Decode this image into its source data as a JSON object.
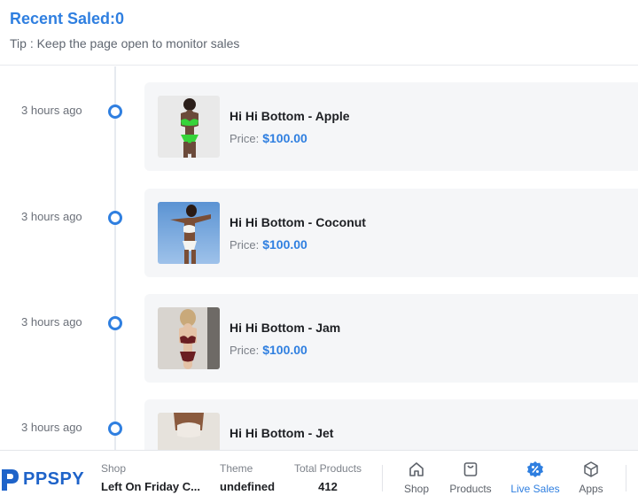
{
  "header": {
    "title": "Recent Saled:0",
    "tip": "Tip : Keep the page open to monitor sales"
  },
  "price_label": "Price:",
  "sales": [
    {
      "time": "3 hours ago",
      "name": "Hi Hi Bottom - Apple",
      "price": "$100.00",
      "thumb": "bikini-green"
    },
    {
      "time": "3 hours ago",
      "name": "Hi Hi Bottom - Coconut",
      "price": "$100.00",
      "thumb": "bikini-white"
    },
    {
      "time": "3 hours ago",
      "name": "Hi Hi Bottom - Jam",
      "price": "$100.00",
      "thumb": "bikini-maroon"
    },
    {
      "time": "3 hours ago",
      "name": "Hi Hi Bottom - Jet",
      "price": "",
      "thumb": "bikini-jet"
    }
  ],
  "footer": {
    "logo": "PPSPY",
    "shop": {
      "label": "Shop",
      "value": "Left On Friday C..."
    },
    "theme": {
      "label": "Theme",
      "value": "undefined"
    },
    "total_products": {
      "label": "Total Products",
      "value": "412"
    },
    "nav": [
      {
        "label": "Shop",
        "icon": "home-icon",
        "active": false
      },
      {
        "label": "Products",
        "icon": "bag-icon",
        "active": false
      },
      {
        "label": "Live Sales",
        "icon": "percent-badge-icon",
        "active": true
      },
      {
        "label": "Apps",
        "icon": "cube-icon",
        "active": false
      }
    ]
  },
  "colors": {
    "accent": "#2f7fe0",
    "brand": "#1e63c9",
    "card_bg": "#f5f6f8"
  }
}
